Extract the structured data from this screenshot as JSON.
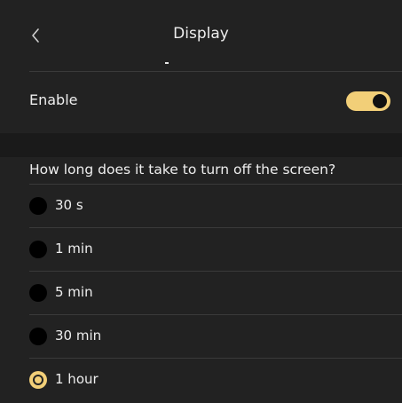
{
  "header": {
    "title": "Display",
    "back_icon": "chevron-left-icon"
  },
  "enable": {
    "label": "Enable",
    "toggle_on": true,
    "accent_color": "#f2cf78"
  },
  "screen_timeout": {
    "question": "How long does it take to turn off the screen?",
    "options": [
      {
        "label": "30 s",
        "selected": false
      },
      {
        "label": "1 min",
        "selected": false
      },
      {
        "label": "5 min",
        "selected": false
      },
      {
        "label": "30 min",
        "selected": false
      },
      {
        "label": "1 hour",
        "selected": true
      }
    ]
  },
  "colors": {
    "background": "#222222",
    "section_band": "#1a1a1a",
    "accent": "#f2cf78",
    "text": "#eeeeee"
  }
}
